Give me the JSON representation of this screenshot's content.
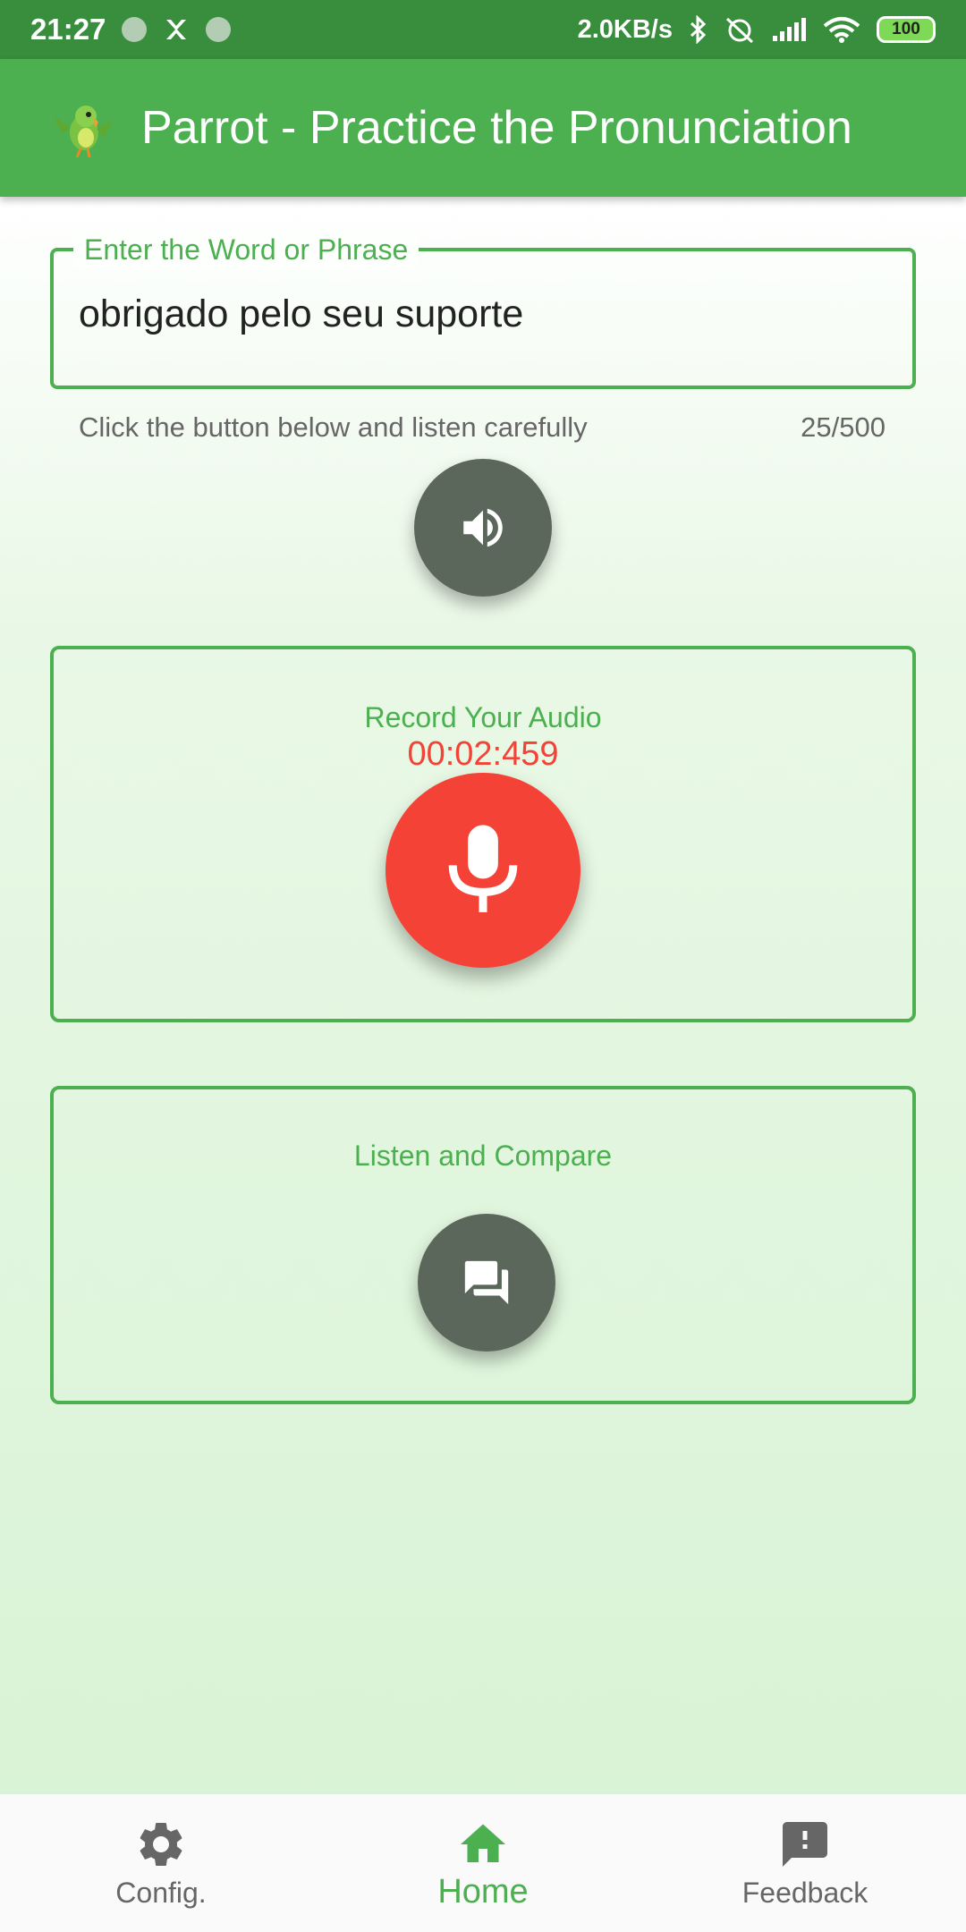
{
  "status_bar": {
    "time": "21:27",
    "network_speed": "2.0KB/s",
    "battery": "100"
  },
  "app_bar": {
    "title": "Parrot - Practice the Pronunciation",
    "logo_icon": "parrot-icon"
  },
  "input": {
    "label": "Enter the Word or Phrase",
    "value": "obrigado pelo seu suporte",
    "helper": "Click the button below and listen carefully",
    "counter": "25/500"
  },
  "speaker": {
    "icon": "speaker-icon"
  },
  "record": {
    "title": "Record Your Audio",
    "timer": "00:02:459",
    "icon": "microphone-icon"
  },
  "compare": {
    "title": "Listen and Compare",
    "icon": "forum-icon"
  },
  "bottom_nav": {
    "items": [
      {
        "label": "Config.",
        "icon": "gear-icon"
      },
      {
        "label": "Home",
        "icon": "home-icon",
        "active": true
      },
      {
        "label": "Feedback",
        "icon": "feedback-icon"
      }
    ]
  },
  "colors": {
    "primary": "#4caf50",
    "primary_dark": "#388e3c",
    "record": "#f44336",
    "fab_gray": "#5b675b"
  }
}
